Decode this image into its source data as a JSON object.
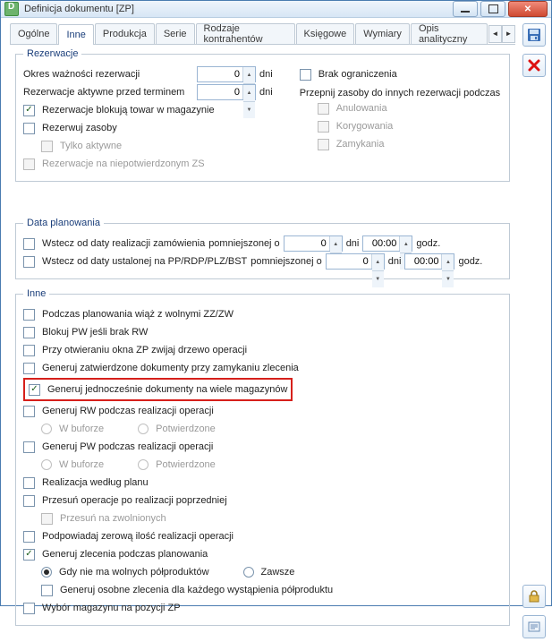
{
  "window": {
    "title": "Definicja dokumentu [ZP]"
  },
  "tabs": {
    "items": [
      "Ogólne",
      "Inne",
      "Produkcja",
      "Serie",
      "Rodzaje kontrahentów",
      "Księgowe",
      "Wymiary",
      "Opis analityczny"
    ],
    "active": 1
  },
  "reservations": {
    "legend": "Rezerwacje",
    "period_label": "Okres ważności rezerwacji",
    "period_value": "0",
    "unit": "dni",
    "active_before_label": "Rezerwacje aktywne przed terminem",
    "active_before_value": "0",
    "no_limit_label": "Brak ograniczenia",
    "no_limit_checked": false,
    "block_stock_label": "Rezerwacje blokują towar w magazynie",
    "block_stock_checked": true,
    "reserve_resources_label": "Rezerwuj zasoby",
    "reserve_resources_checked": false,
    "only_active_label": "Tylko aktywne",
    "on_unconfirmed_label": "Rezerwacje na niepotwierdzonym ZS",
    "reassign_legend": "Przepnij zasoby do innych rezerwacji podczas",
    "reassign_cancel": "Anulowania",
    "reassign_correct": "Korygowania",
    "reassign_close": "Zamykania"
  },
  "planning": {
    "legend": "Data planowania",
    "back_from_order_label": "Wstecz od daty realizacji zamówienia",
    "reduced_by": "pomniejszonej o",
    "value1": "0",
    "unit_days": "dni",
    "time1": "00:00",
    "unit_hours": "godz.",
    "back_from_pp_label": "Wstecz od daty ustalonej na PP/RDP/PLZ/BST",
    "value2": "0",
    "time2": "00:00"
  },
  "other": {
    "legend": "Inne",
    "bind_free": "Podczas planowania wiąż z wolnymi ZZ/ZW",
    "block_pw": "Blokuj PW jeśli brak RW",
    "collapse_tree": "Przy otwieraniu okna ZP zwijaj drzewo operacji",
    "gen_approved": "Generuj zatwierdzone dokumenty przy zamykaniu zlecenia",
    "gen_multi_wh": "Generuj jednocześnie dokumenty na wiele magazynów",
    "gen_rw": "Generuj RW podczas realizacji operacji",
    "buf": "W buforze",
    "conf": "Potwierdzone",
    "gen_pw": "Generuj PW podczas realizacji operacji",
    "plan_realization": "Realizacja według planu",
    "shift_ops": "Przesuń operacje po realizacji poprzedniej",
    "shift_released": "Przesuń na zwolnionych",
    "suggest_zero": "Podpowiadaj zerową ilość realizacji operacji",
    "gen_orders": "Generuj zlecenia podczas planowania",
    "when_no_free": "Gdy nie ma wolnych półproduktów",
    "always": "Zawsze",
    "gen_separate": "Generuj osobne zlecenia dla każdego wystąpienia półproduktu",
    "wh_on_pos": "Wybór magazynu na pozycji ZP"
  }
}
